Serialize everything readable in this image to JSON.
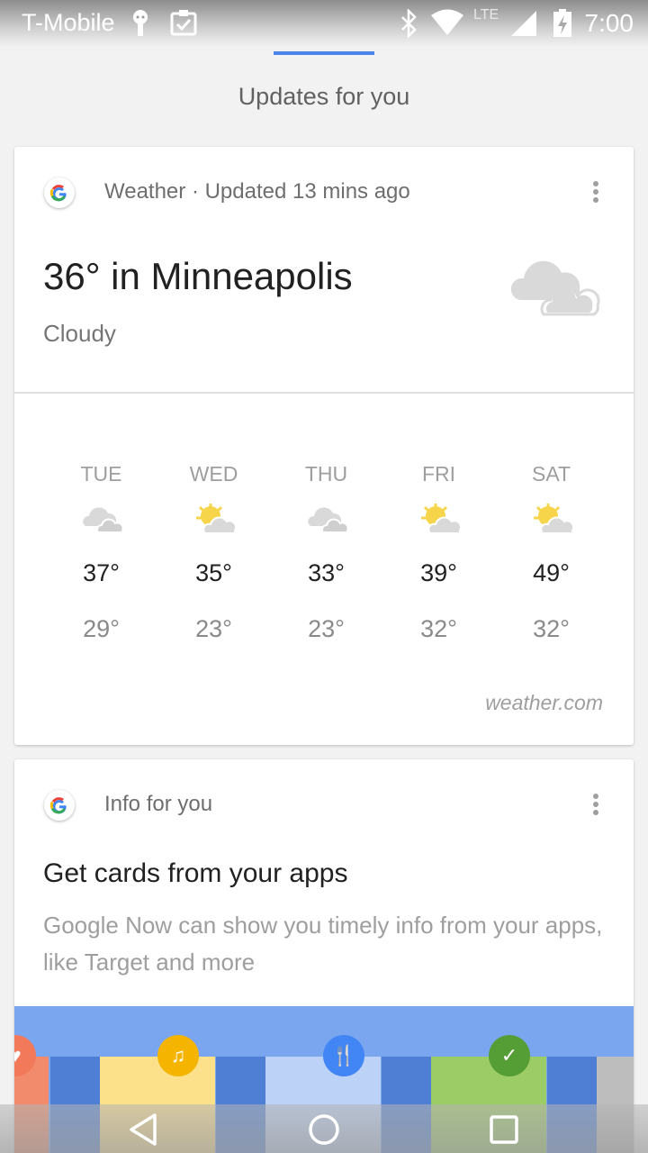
{
  "status_bar": {
    "carrier": "T-Mobile",
    "network": "LTE",
    "time": "7:00"
  },
  "header": {
    "title": "Updates for you"
  },
  "weather_card": {
    "source": "Weather · Updated 13 mins ago",
    "headline": "36° in Minneapolis",
    "condition": "Cloudy",
    "attribution": "weather.com",
    "forecast": [
      {
        "day": "TUE",
        "high": "37°",
        "low": "29°",
        "icon": "cloudy-icon"
      },
      {
        "day": "WED",
        "high": "35°",
        "low": "23°",
        "icon": "partly-sunny-icon"
      },
      {
        "day": "THU",
        "high": "33°",
        "low": "23°",
        "icon": "cloudy-icon"
      },
      {
        "day": "FRI",
        "high": "39°",
        "low": "32°",
        "icon": "partly-sunny-icon"
      },
      {
        "day": "SAT",
        "high": "49°",
        "low": "32°",
        "icon": "partly-sunny-icon"
      }
    ]
  },
  "info_card": {
    "source": "Info for you",
    "title": "Get cards from your apps",
    "body": "Google Now can show you timely info from your apps, like Target and more",
    "badges": [
      "music-icon",
      "restaurant-icon",
      "check-icon"
    ]
  },
  "colors": {
    "accent": "#4a86e8",
    "promo_bg": "#7aa6f0",
    "sun": "#f6d54a"
  }
}
